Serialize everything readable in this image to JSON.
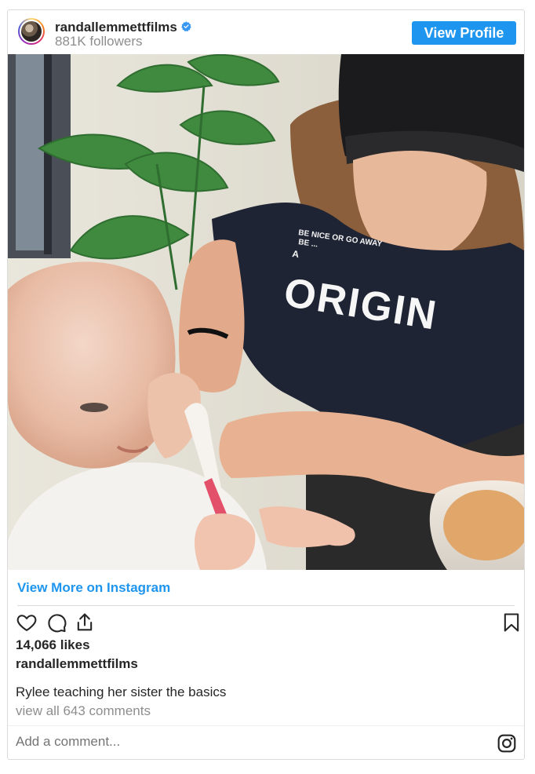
{
  "header": {
    "username": "randallemmettfilms",
    "followers": "881K followers",
    "view_profile_label": "View Profile",
    "verified_icon": "verified-badge-icon"
  },
  "post": {
    "image_alt": "Rylee teaching her sister the basics",
    "view_more_label": "View More on Instagram",
    "likes": "14,066 likes",
    "caption_username": "randallemmettfilms",
    "caption": "Rylee teaching her sister the basics",
    "view_comments": "view all 643 comments",
    "shirt_small_text_1": "BE NICE OR GO AWAY",
    "shirt_small_text_2": "BE ...",
    "shirt_small_text_3": "A",
    "shirt_big_text": "ORIGIN"
  },
  "actions": {
    "icons": [
      "heart-icon",
      "comment-icon",
      "share-icon",
      "bookmark-icon"
    ]
  },
  "comment_box": {
    "placeholder": "Add a comment...",
    "icon": "instagram-icon"
  },
  "colors": {
    "accent": "#1e95ee",
    "muted": "#8e8e8e",
    "text": "#262626"
  }
}
